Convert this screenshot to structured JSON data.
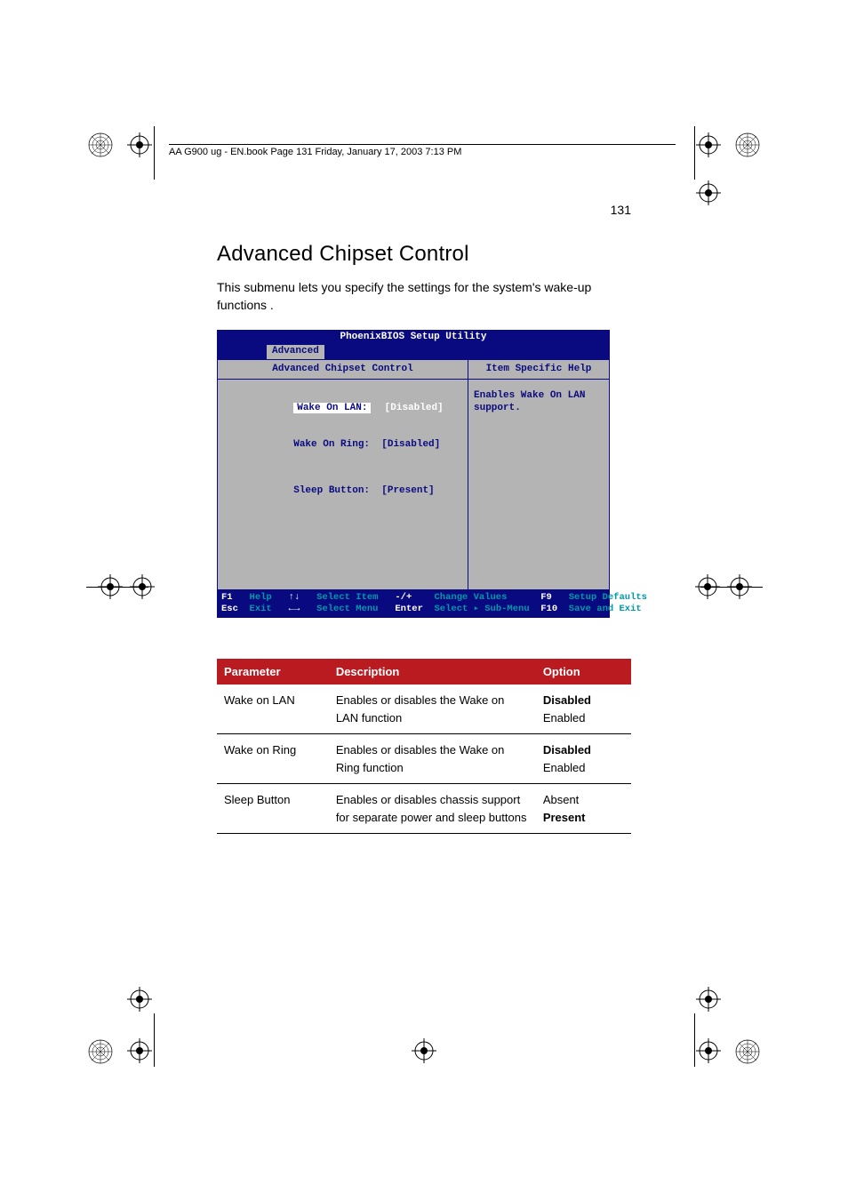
{
  "running_header": "AA G900 ug - EN.book  Page 131  Friday, January 17, 2003  7:13 PM",
  "page_number": "131",
  "heading": "Advanced Chipset Control",
  "intro": "This submenu lets you specify the settings for the system's wake-up functions .",
  "bios": {
    "title": "PhoenixBIOS Setup Utility",
    "tab": "Advanced",
    "submenu_title": "Advanced Chipset Control",
    "help_title": "Item Specific Help",
    "help_body": "Enables Wake On LAN support.",
    "fields": [
      {
        "label": "Wake On LAN:",
        "value": "[Disabled]",
        "selected": true
      },
      {
        "label": "Wake On Ring:",
        "value": "[Disabled]",
        "selected": false
      },
      {
        "label": "Sleep Button:",
        "value": "[Present]",
        "selected": false
      }
    ],
    "footer_line1_keys": "F1",
    "footer_line1_a": "Help",
    "footer_line1_k2": "↑↓",
    "footer_line1_a2": "Select Item",
    "footer_line1_k3": "-/+",
    "footer_line1_a3": "Change Values",
    "footer_line1_k4": "F9",
    "footer_line1_a4": "Setup Defaults",
    "footer_line2_keys": "Esc",
    "footer_line2_a": "Exit",
    "footer_line2_k2": "←→",
    "footer_line2_a2": "Select Menu",
    "footer_line2_k3": "Enter",
    "footer_line2_a3": "Select ▸ Sub-Menu",
    "footer_line2_k4": "F10",
    "footer_line2_a4": "Save and Exit"
  },
  "table": {
    "headers": {
      "c1": "Parameter",
      "c2": "Description",
      "c3": "Option"
    },
    "rows": [
      {
        "param": "Wake on LAN",
        "desc": "Enables or disables the Wake on LAN function",
        "opt_default": "Disabled",
        "opt_other": "Enabled"
      },
      {
        "param": "Wake on Ring",
        "desc": "Enables or disables the Wake on Ring function",
        "opt_default": "Disabled",
        "opt_other": "Enabled"
      },
      {
        "param": "Sleep Button",
        "desc": "Enables or disables chassis support for separate power and sleep buttons",
        "opt_other_first": "Absent",
        "opt_default": "Present"
      }
    ]
  }
}
